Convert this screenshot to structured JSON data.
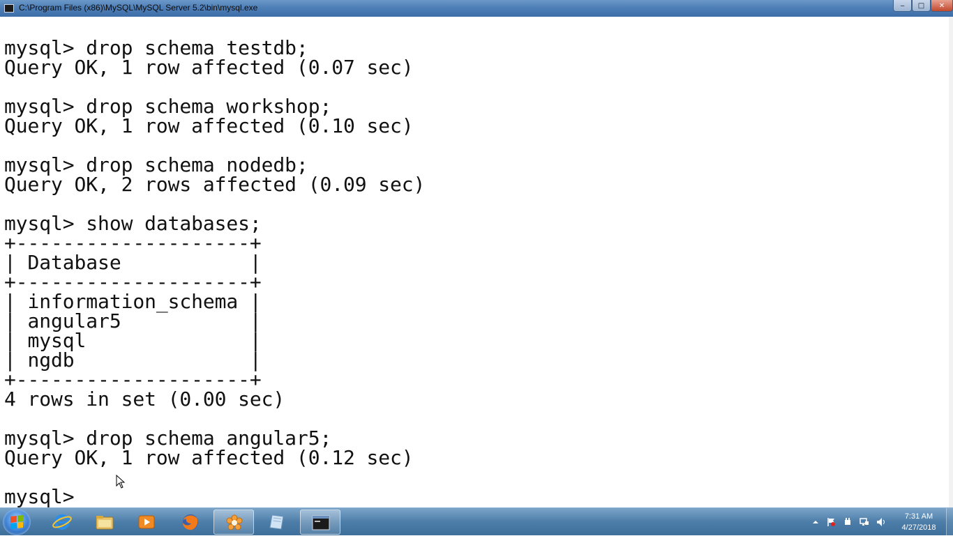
{
  "window": {
    "title": "C:\\Program Files (x86)\\MySQL\\MySQL Server 5.2\\bin\\mysql.exe",
    "minimize_glyph": "‒",
    "maximize_glyph": "□",
    "close_glyph": "✕"
  },
  "console": {
    "lines": [
      "mysql> drop schema testdb;",
      "Query OK, 1 row affected (0.07 sec)",
      "",
      "mysql> drop schema workshop;",
      "Query OK, 1 row affected (0.10 sec)",
      "",
      "mysql> drop schema nodedb;",
      "Query OK, 2 rows affected (0.09 sec)",
      "",
      "mysql> show databases;",
      "+--------------------+",
      "| Database           |",
      "+--------------------+",
      "| information_schema |",
      "| angular5           |",
      "| mysql              |",
      "| ngdb               |",
      "+--------------------+",
      "4 rows in set (0.00 sec)",
      "",
      "mysql> drop schema angular5;",
      "Query OK, 1 row affected (0.12 sec)",
      "",
      "mysql> "
    ]
  },
  "taskbar": {
    "items": [
      {
        "icon": "internet-explorer-icon",
        "active": false
      },
      {
        "icon": "file-explorer-icon",
        "active": false
      },
      {
        "icon": "media-player-icon",
        "active": false
      },
      {
        "icon": "firefox-icon",
        "active": false
      },
      {
        "icon": "flower-app-icon",
        "active": true
      },
      {
        "icon": "document-app-icon",
        "active": false
      },
      {
        "icon": "console-window-icon",
        "active": true
      }
    ],
    "tray_icons": [
      "show-hidden-icons-arrow",
      "action-center-flag-icon",
      "power-plug-icon",
      "network-icon",
      "volume-icon"
    ],
    "clock": {
      "time": "7:31 AM",
      "date": "4/27/2018"
    }
  },
  "colors": {
    "titlebar": "#4f7fb7",
    "console_bg": "#ffffff",
    "console_text": "#111111",
    "taskbar": "#4d7ea9"
  }
}
